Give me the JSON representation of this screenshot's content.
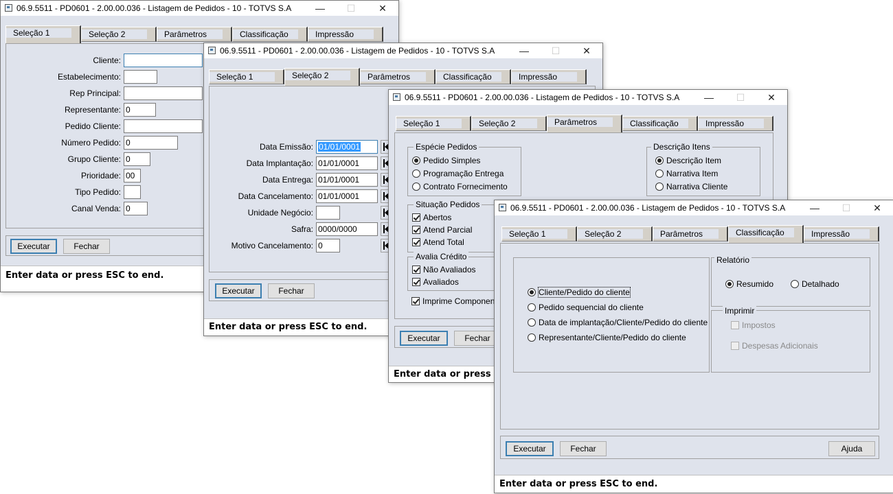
{
  "title": "06.9.5511 - PD0601 - 2.00.00.036 - Listagem de Pedidos - 10 - TOTVS S.A",
  "window_buttons": {
    "minimize": "—",
    "maximize": "☐",
    "close": "✕"
  },
  "tabs": [
    "Seleção 1",
    "Seleção 2",
    "Parâmetros",
    "Classificação",
    "Impressão"
  ],
  "buttons": {
    "execute": "Executar",
    "close": "Fechar",
    "help": "Ajuda"
  },
  "status": "Enter data or press ESC to end.",
  "selecao1": {
    "fields": [
      {
        "label": "Cliente:",
        "value": ""
      },
      {
        "label": "Estabelecimento:",
        "value": ""
      },
      {
        "label": "Rep Principal:",
        "value": ""
      },
      {
        "label": "Representante:",
        "value": "0"
      },
      {
        "label": "Pedido Cliente:",
        "value": ""
      },
      {
        "label": "Número Pedido:",
        "value": "0"
      },
      {
        "label": "Grupo Cliente:",
        "value": "0"
      },
      {
        "label": "Prioridade:",
        "value": "00"
      },
      {
        "label": "Tipo Pedido:",
        "value": ""
      },
      {
        "label": "Canal Venda:",
        "value": "0"
      }
    ]
  },
  "selecao2": {
    "fields": [
      {
        "label": "Data Emissão:",
        "value": "01/01/0001"
      },
      {
        "label": "Data Implantação:",
        "value": "01/01/0001"
      },
      {
        "label": "Data Entrega:",
        "value": "01/01/0001"
      },
      {
        "label": "Data Cancelamento:",
        "value": "01/01/0001"
      },
      {
        "label": "Unidade Negócio:",
        "value": ""
      },
      {
        "label": "Safra:",
        "value": "0000/0000"
      },
      {
        "label": "Motivo Cancelamento:",
        "value": "0"
      }
    ]
  },
  "parametros": {
    "especie": {
      "title": "Espécie Pedidos",
      "options": [
        "Pedido Simples",
        "Programação Entrega",
        "Contrato Fornecimento"
      ],
      "selected": 0
    },
    "descricao": {
      "title": "Descrição Itens",
      "options": [
        "Descrição Item",
        "Narrativa Item",
        "Narrativa Cliente"
      ],
      "selected": 0
    },
    "situacao": {
      "title": "Situação Pedidos",
      "options": [
        "Abertos",
        "Atend Parcial",
        "Atend Total"
      ],
      "checked": [
        true,
        true,
        true
      ]
    },
    "avalia": {
      "title": "Avalia Crédito",
      "options": [
        "Não Avaliados",
        "Avaliados"
      ],
      "checked": [
        true,
        true
      ]
    },
    "imprime": {
      "label": "Imprime Componentes",
      "checked": true
    }
  },
  "classificacao": {
    "options": [
      "Cliente/Pedido do cliente",
      "Pedido sequencial do cliente",
      "Data de implantação/Cliente/Pedido do cliente",
      "Representante/Cliente/Pedido do cliente"
    ],
    "selected": 0,
    "relatorio": {
      "title": "Relatório",
      "options": [
        "Resumido",
        "Detalhado"
      ],
      "selected": 0
    },
    "imprimir": {
      "title": "Imprimir",
      "options": [
        "Impostos",
        "Despesas Adicionais"
      ]
    }
  }
}
